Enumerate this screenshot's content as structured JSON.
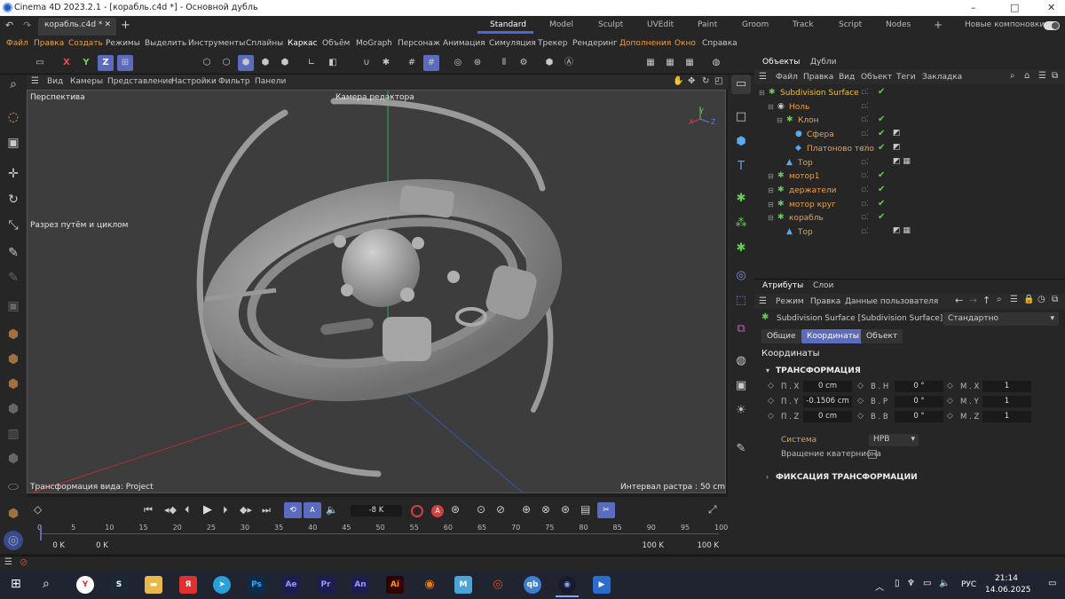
{
  "window": {
    "title": "Cinema 4D 2023.2.1 - [корабль.c4d *] - Основной дубль",
    "controls": [
      "–",
      "□",
      "✕"
    ]
  },
  "doc_tab": {
    "label": "корабль.c4d *",
    "close": "✕",
    "add": "+"
  },
  "layouts": [
    "Standard",
    "Model",
    "Sculpt",
    "UVEdit",
    "Paint",
    "Groom",
    "Track",
    "Script",
    "Nodes"
  ],
  "layout_add": "+",
  "new_layouts": "Новые компоновки",
  "menu": [
    "Файл",
    "Правка",
    "Создать",
    "Режимы",
    "Выделить",
    "Инструменты",
    "Сплайны",
    "Каркас",
    "Объём",
    "MoGraph",
    "Персонаж",
    "Анимация",
    "Симуляция",
    "Трекер",
    "Рендеринг",
    "Дополнения",
    "Окно",
    "Справка"
  ],
  "viewport_menu": [
    "Вид",
    "Камеры",
    "Представление",
    "Настройки",
    "Фильтр",
    "Панели"
  ],
  "viewport": {
    "name": "Перспектива",
    "camera": "Камера редактора",
    "overlay_text": "Разрез путём и циклом",
    "status_left": "Трансформация вида: Project",
    "status_right": "Интервал растра : 50 cm"
  },
  "axis_labels": {
    "x": "X",
    "y": "Y",
    "z": "Z"
  },
  "toolbar_axes": [
    "X",
    "Y",
    "Z"
  ],
  "timeline": {
    "current_frame": "-8 K",
    "ticks": [
      "0",
      "5",
      "10",
      "15",
      "20",
      "25",
      "30",
      "35",
      "40",
      "45",
      "50",
      "55",
      "60",
      "65",
      "70",
      "75",
      "80",
      "85",
      "90",
      "95",
      "100"
    ],
    "start": "0 K",
    "start2": "0 K",
    "end": "100 K",
    "end2": "100 K"
  },
  "obj_panel": {
    "tabs": [
      "Объекты",
      "Дубли"
    ],
    "menu": [
      "Файл",
      "Правка",
      "Вид",
      "Объект",
      "Теги",
      "Закладка"
    ],
    "items": [
      {
        "label": "Subdivision Surface",
        "indent": 0,
        "icon": "✱",
        "check": true
      },
      {
        "label": "Ноль",
        "indent": 1,
        "icon": "◉",
        "check": false
      },
      {
        "label": "Клон",
        "indent": 2,
        "icon": "✱",
        "check": true
      },
      {
        "label": "Сфера",
        "indent": 3,
        "icon": "●",
        "check": true
      },
      {
        "label": "Платоново тело",
        "indent": 3,
        "icon": "◆",
        "check": true
      },
      {
        "label": "Тор",
        "indent": 2,
        "icon": "▲",
        "check": false
      },
      {
        "label": "мотор1",
        "indent": 1,
        "icon": "✱",
        "check": true
      },
      {
        "label": "держатели",
        "indent": 1,
        "icon": "✱",
        "check": true
      },
      {
        "label": "мотор круг",
        "indent": 1,
        "icon": "✱",
        "check": true
      },
      {
        "label": "корабль",
        "indent": 1,
        "icon": "✱",
        "check": true
      },
      {
        "label": "Тор",
        "indent": 2,
        "icon": "▲",
        "check": false
      }
    ]
  },
  "attr_panel": {
    "tabs": [
      "Атрибуты",
      "Слои"
    ],
    "menu": [
      "Режим",
      "Правка",
      "Данные пользователя"
    ],
    "object": "Subdivision Surface [Subdivision Surface]",
    "preset": "Стандартно",
    "subtabs": [
      "Общие",
      "Координаты",
      "Объект"
    ],
    "section": "Координаты",
    "group": "ТРАНСФОРМАЦИЯ",
    "rows": [
      {
        "p_label": "П . X",
        "p_val": "0 cm",
        "r_label": "В . Н",
        "r_val": "0 °",
        "s_label": "М . X",
        "s_val": "1"
      },
      {
        "p_label": "П . Y",
        "p_val": "-0.1506 cm",
        "r_label": "В . Р",
        "r_val": "0 °",
        "s_label": "М . Y",
        "s_val": "1"
      },
      {
        "p_label": "П . Z",
        "p_val": "0 cm",
        "r_label": "В . В",
        "r_val": "0 °",
        "s_label": "М . Z",
        "s_val": "1"
      }
    ],
    "system_label": "Система",
    "system_val": "HPB",
    "quat_label": "Вращение кватерниона",
    "group2": "ФИКСАЦИЯ ТРАНСФОРМАЦИИ"
  },
  "taskbar": {
    "lang": "РУС",
    "time": "21:14",
    "date": "14.06.2025"
  },
  "colors": {
    "accent": "#5a6bc0",
    "orange": "#e8a24a",
    "green": "#66cc55",
    "viewport": "#3d3d3d"
  }
}
